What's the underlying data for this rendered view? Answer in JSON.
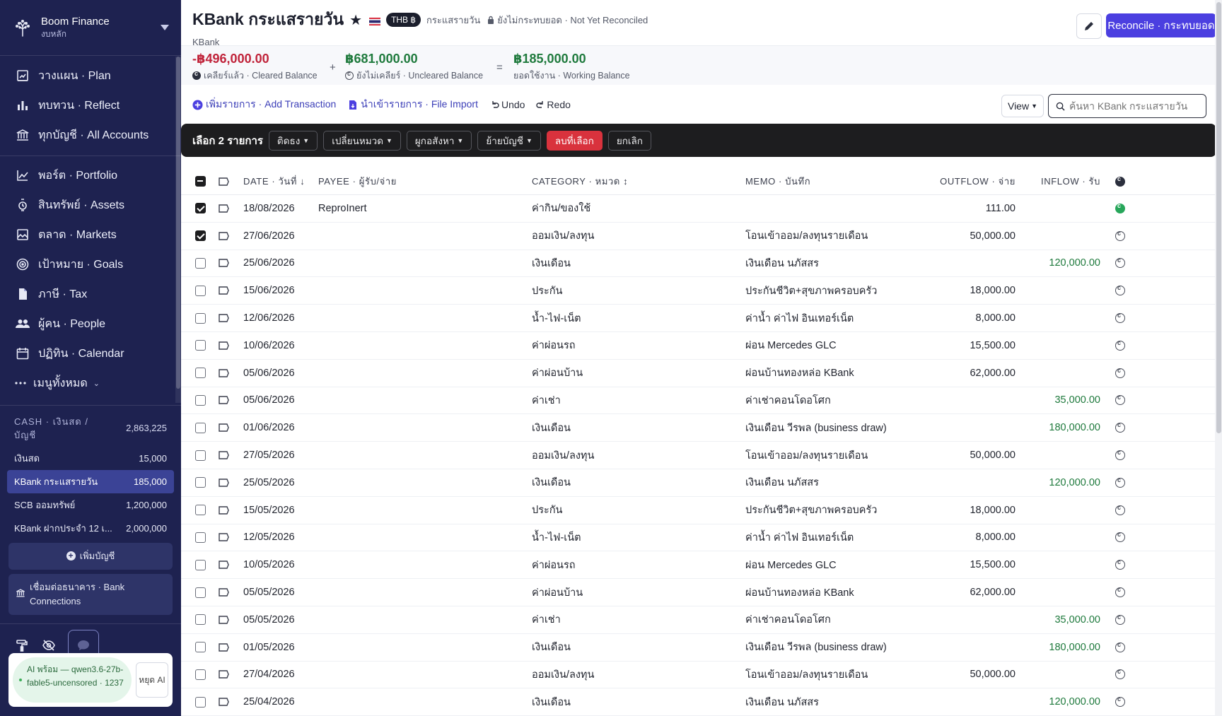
{
  "brand": {
    "name": "Boom Finance",
    "sub": "งบหลัก"
  },
  "nav": [
    {
      "key": "plan",
      "label": "วางแผน · Plan",
      "icon": "plan-icon"
    },
    {
      "key": "reflect",
      "label": "ทบทวน · Reflect",
      "icon": "bar-chart-icon"
    },
    {
      "key": "accounts",
      "label": "ทุกบัญชี · All Accounts",
      "icon": "bank-icon"
    }
  ],
  "nav2": [
    {
      "key": "portfolio",
      "label": "พอร์ต · Portfolio",
      "icon": "line-chart-icon"
    },
    {
      "key": "assets",
      "label": "สินทรัพย์ · Assets",
      "icon": "watch-icon"
    },
    {
      "key": "markets",
      "label": "ตลาด · Markets",
      "icon": "image-icon"
    },
    {
      "key": "goals",
      "label": "เป้าหมาย · Goals",
      "icon": "target-icon"
    },
    {
      "key": "tax",
      "label": "ภาษี · Tax",
      "icon": "document-icon"
    },
    {
      "key": "people",
      "label": "ผู้คน · People",
      "icon": "people-icon"
    },
    {
      "key": "calendar",
      "label": "ปฏิทิน · Calendar",
      "icon": "calendar-icon"
    },
    {
      "key": "more",
      "label": "เมนูทั้งหมด",
      "icon": "dots-icon"
    }
  ],
  "cash": {
    "label": "CASH · เงินสด / บัญชี",
    "total": "2,863,225"
  },
  "accounts": [
    {
      "name": "เงินสด",
      "value": "15,000"
    },
    {
      "name": "KBank กระแสรายวัน",
      "value": "185,000"
    },
    {
      "name": "SCB ออมทรัพย์",
      "value": "1,200,000"
    },
    {
      "name": "KBank ฝากประจำ 12 เ...",
      "value": "2,000,000"
    }
  ],
  "sidebar_buttons": {
    "add_account": "เพิ่มบัญชี",
    "bank_connections": "เชื่อมต่อธนาคาร · Bank Connections"
  },
  "ai": {
    "status": "AI พร้อม — qwen3.6-27b-fable5-uncensored · 1237",
    "stop": "หยุด AI"
  },
  "header": {
    "title": "KBank กระแสรายวัน",
    "currency": "THB ฿",
    "type": "กระแสรายวัน",
    "reconcile_state": "ยังไม่กระทบยอด · Not Yet Reconciled",
    "bank": "KBank",
    "reconcile_button": "Reconcile · กระทบยอด"
  },
  "balances": {
    "cleared": {
      "amount": "-฿496,000.00",
      "label": "เคลียร์แล้ว · Cleared Balance",
      "color": "#c0233a"
    },
    "plus": "+",
    "uncleared": {
      "amount": "฿681,000.00",
      "label": "ยังไม่เคลียร์ · Uncleared Balance",
      "color": "#1f7a3d"
    },
    "equals": "=",
    "working": {
      "amount": "฿185,000.00",
      "label": "ยอดใช้งาน · Working Balance",
      "color": "#1f7a3d"
    }
  },
  "toolbar": {
    "add": "เพิ่มรายการ · Add Transaction",
    "import": "นำเข้ารายการ · File Import",
    "undo": "Undo",
    "redo": "Redo",
    "view": "View",
    "search_placeholder": "ค้นหา KBank กระแสรายวัน"
  },
  "selection": {
    "count": "เลือก 2 รายการ",
    "buttons": [
      "ติดธง",
      "เปลี่ยนหมวด",
      "ผูกอสังหา",
      "ย้ายบัญชี"
    ],
    "delete": "ลบที่เลือก",
    "cancel": "ยกเลิก"
  },
  "columns": {
    "date": "DATE · วันที่ ↓",
    "payee": "PAYEE · ผู้รับ/จ่าย",
    "category": "CATEGORY · หมวด ↕",
    "memo": "MEMO · บันทึก",
    "outflow": "OUTFLOW · จ่าย",
    "inflow": "INFLOW · รับ"
  },
  "rows": [
    {
      "checked": true,
      "date": "18/08/2026",
      "payee": "ReproInert",
      "category": "ค่ากิน/ของใช้",
      "memo": "",
      "outflow": "111.00",
      "inflow": "",
      "cleared": true
    },
    {
      "checked": true,
      "date": "27/06/2026",
      "payee": "",
      "category": "ออมเงิน/ลงทุน",
      "memo": "โอนเข้าออม/ลงทุนรายเดือน",
      "outflow": "50,000.00",
      "inflow": "",
      "cleared": false
    },
    {
      "checked": false,
      "date": "25/06/2026",
      "payee": "",
      "category": "เงินเดือน",
      "memo": "เงินเดือน นภัสสร",
      "outflow": "",
      "inflow": "120,000.00",
      "cleared": false
    },
    {
      "checked": false,
      "date": "15/06/2026",
      "payee": "",
      "category": "ประกัน",
      "memo": "ประกันชีวิต+สุขภาพครอบครัว",
      "outflow": "18,000.00",
      "inflow": "",
      "cleared": false
    },
    {
      "checked": false,
      "date": "12/06/2026",
      "payee": "",
      "category": "น้ำ-ไฟ-เน็ต",
      "memo": "ค่าน้ำ ค่าไฟ อินเทอร์เน็ต",
      "outflow": "8,000.00",
      "inflow": "",
      "cleared": false
    },
    {
      "checked": false,
      "date": "10/06/2026",
      "payee": "",
      "category": "ค่าผ่อนรถ",
      "memo": "ผ่อน Mercedes GLC",
      "outflow": "15,500.00",
      "inflow": "",
      "cleared": false
    },
    {
      "checked": false,
      "date": "05/06/2026",
      "payee": "",
      "category": "ค่าผ่อนบ้าน",
      "memo": "ผ่อนบ้านทองหล่อ KBank",
      "outflow": "62,000.00",
      "inflow": "",
      "cleared": false
    },
    {
      "checked": false,
      "date": "05/06/2026",
      "payee": "",
      "category": "ค่าเช่า",
      "memo": "ค่าเช่าคอนโดอโศก",
      "outflow": "",
      "inflow": "35,000.00",
      "cleared": false
    },
    {
      "checked": false,
      "date": "01/06/2026",
      "payee": "",
      "category": "เงินเดือน",
      "memo": "เงินเดือน วีรพล (business draw)",
      "outflow": "",
      "inflow": "180,000.00",
      "cleared": false
    },
    {
      "checked": false,
      "date": "27/05/2026",
      "payee": "",
      "category": "ออมเงิน/ลงทุน",
      "memo": "โอนเข้าออม/ลงทุนรายเดือน",
      "outflow": "50,000.00",
      "inflow": "",
      "cleared": false
    },
    {
      "checked": false,
      "date": "25/05/2026",
      "payee": "",
      "category": "เงินเดือน",
      "memo": "เงินเดือน นภัสสร",
      "outflow": "",
      "inflow": "120,000.00",
      "cleared": false
    },
    {
      "checked": false,
      "date": "15/05/2026",
      "payee": "",
      "category": "ประกัน",
      "memo": "ประกันชีวิต+สุขภาพครอบครัว",
      "outflow": "18,000.00",
      "inflow": "",
      "cleared": false
    },
    {
      "checked": false,
      "date": "12/05/2026",
      "payee": "",
      "category": "น้ำ-ไฟ-เน็ต",
      "memo": "ค่าน้ำ ค่าไฟ อินเทอร์เน็ต",
      "outflow": "8,000.00",
      "inflow": "",
      "cleared": false
    },
    {
      "checked": false,
      "date": "10/05/2026",
      "payee": "",
      "category": "ค่าผ่อนรถ",
      "memo": "ผ่อน Mercedes GLC",
      "outflow": "15,500.00",
      "inflow": "",
      "cleared": false
    },
    {
      "checked": false,
      "date": "05/05/2026",
      "payee": "",
      "category": "ค่าผ่อนบ้าน",
      "memo": "ผ่อนบ้านทองหล่อ KBank",
      "outflow": "62,000.00",
      "inflow": "",
      "cleared": false
    },
    {
      "checked": false,
      "date": "05/05/2026",
      "payee": "",
      "category": "ค่าเช่า",
      "memo": "ค่าเช่าคอนโดอโศก",
      "outflow": "",
      "inflow": "35,000.00",
      "cleared": false
    },
    {
      "checked": false,
      "date": "01/05/2026",
      "payee": "",
      "category": "เงินเดือน",
      "memo": "เงินเดือน วีรพล (business draw)",
      "outflow": "",
      "inflow": "180,000.00",
      "cleared": false
    },
    {
      "checked": false,
      "date": "27/04/2026",
      "payee": "",
      "category": "ออมเงิน/ลงทุน",
      "memo": "โอนเข้าออม/ลงทุนรายเดือน",
      "outflow": "50,000.00",
      "inflow": "",
      "cleared": false
    },
    {
      "checked": false,
      "date": "25/04/2026",
      "payee": "",
      "category": "เงินเดือน",
      "memo": "เงินเดือน นภัสสร",
      "outflow": "",
      "inflow": "120,000.00",
      "cleared": false
    }
  ],
  "colors": {
    "sidebar": "#1e2250",
    "accent": "#4b3fe0",
    "danger": "#d9323d",
    "inflow": "#1f7a3d"
  }
}
